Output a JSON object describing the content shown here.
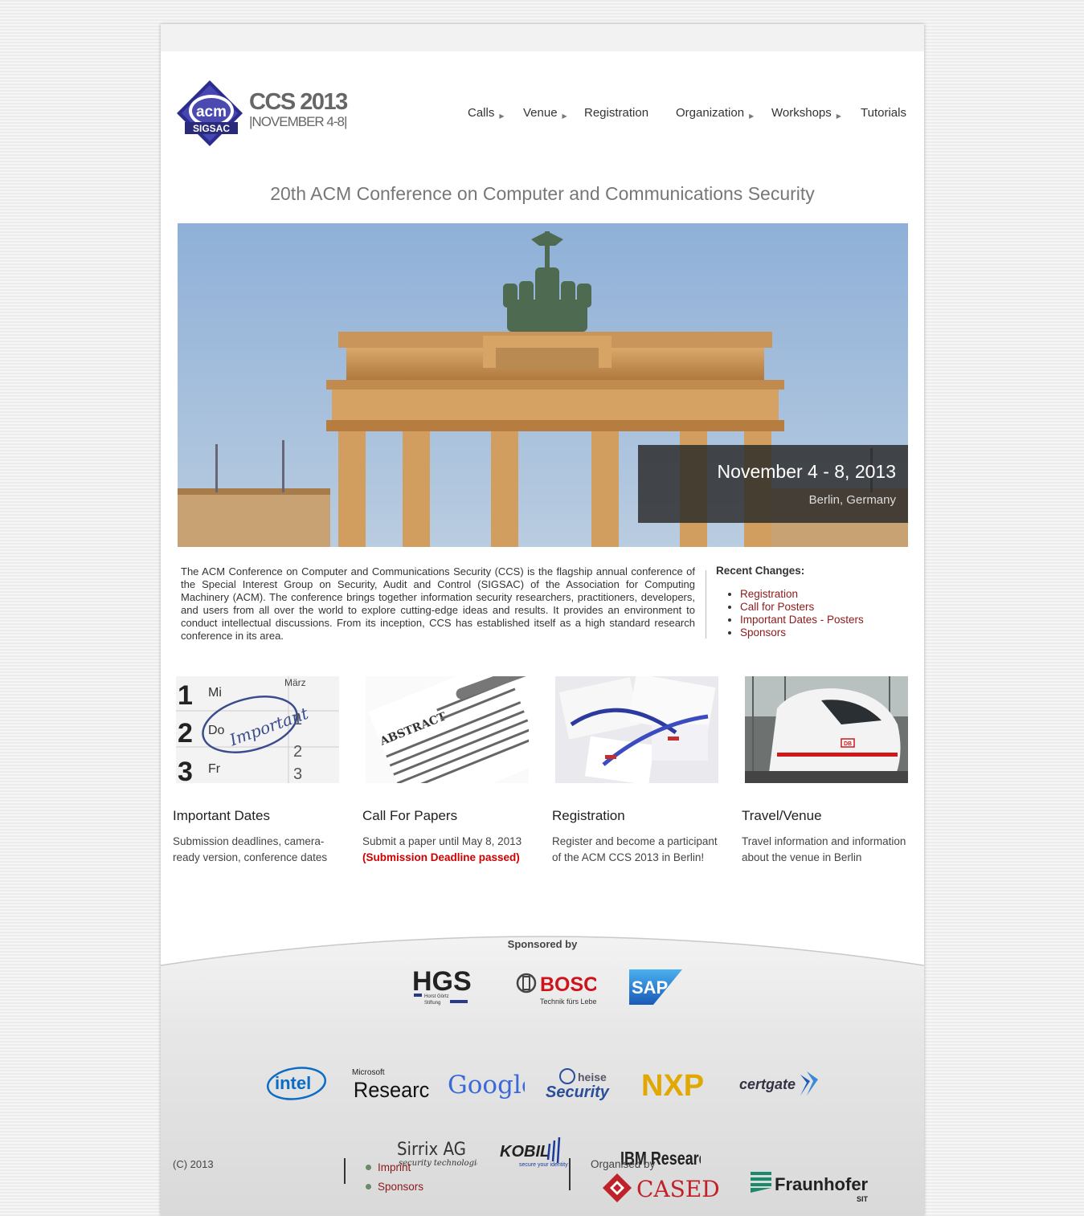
{
  "header": {
    "logo_top": "acm",
    "logo_bottom": "SIGSAC",
    "brand_name": "CCS 2013",
    "brand_dates": "|NOVEMBER 4-8|"
  },
  "nav": [
    {
      "label": "Calls",
      "arrow": "▶"
    },
    {
      "label": "Venue",
      "arrow": "▶"
    },
    {
      "label": "Registration"
    },
    {
      "label": "Organization",
      "arrow": "▶"
    },
    {
      "label": "Workshops",
      "arrow": "▶"
    },
    {
      "label": "Tutorials"
    }
  ],
  "headline": "20th ACM Conference on Computer and Communications Security",
  "hero": {
    "date": "November 4 - 8, 2013",
    "location": "Berlin, Germany"
  },
  "intro": "The ACM Conference on Computer and Communications Security (CCS) is the flagship annual conference of the Special Interest Group on Security, Audit and Control (SIGSAC) of the Association for Computing Machinery (ACM). The conference brings together information security researchers, practitioners, developers, and users from all over the world to explore cutting-edge ideas and results. It provides an environment to conduct intellectual discussions. From its inception, CCS has established itself as a high standard research conference in its area.",
  "recent": {
    "title": "Recent Changes:",
    "items": [
      "Registration",
      "Call for Posters",
      "Important Dates - Posters",
      "Sponsors"
    ]
  },
  "cards": [
    {
      "title": "Important Dates",
      "desc": "Submission deadlines, camera-ready version, conference dates",
      "pic_words": [
        "Mi",
        "Do",
        "Fr",
        "März",
        "Important"
      ]
    },
    {
      "title": "Call For Papers",
      "desc": "Submit a paper until May 8, 2013",
      "warn": "(Submission Deadline passed)",
      "pic_words": [
        "ABSTRACT"
      ]
    },
    {
      "title": "Registration",
      "desc": "Register and become a participant of the ACM CCS 2013 in Berlin!"
    },
    {
      "title": "Travel/Venue",
      "desc": "Travel information and information about the venue in Berlin",
      "pic_words": [
        "DB"
      ]
    }
  ],
  "sponsors": {
    "label": "Sponsored by",
    "row1": {
      "hgs": {
        "main": "HGS",
        "sub1": "Horst Görtz",
        "sub2": "Stiftung"
      },
      "bosch": {
        "main": "BOSCH",
        "sub": "Technik fürs Leben"
      },
      "sap": "SAP"
    },
    "row2": {
      "intel": "intel",
      "msr": {
        "top": "Microsoft",
        "main": "Research"
      },
      "google": "Google",
      "heise": {
        "top": "heise",
        "main": "Security"
      },
      "nxp": "NXP",
      "certgate": "certgate"
    },
    "row3": {
      "sirrix": {
        "main": "Sirrix AG",
        "sub": "security technologies"
      },
      "kobil": {
        "main": "KOBIL",
        "sub": "secure your identity"
      },
      "ibm": "IBM Research"
    }
  },
  "footer": {
    "copyright": "(C) 2013",
    "links": [
      "Imprint",
      "Sponsors"
    ],
    "organised_by": "Organised by",
    "cased": "CASED",
    "fraunhofer": {
      "main": "Fraunhofer",
      "sub": "SIT"
    }
  },
  "colors": {
    "link": "#8b1a1a",
    "warning": "#d00000",
    "acm_purple": "#3a3a9a",
    "sky": "#9fb8d6"
  }
}
